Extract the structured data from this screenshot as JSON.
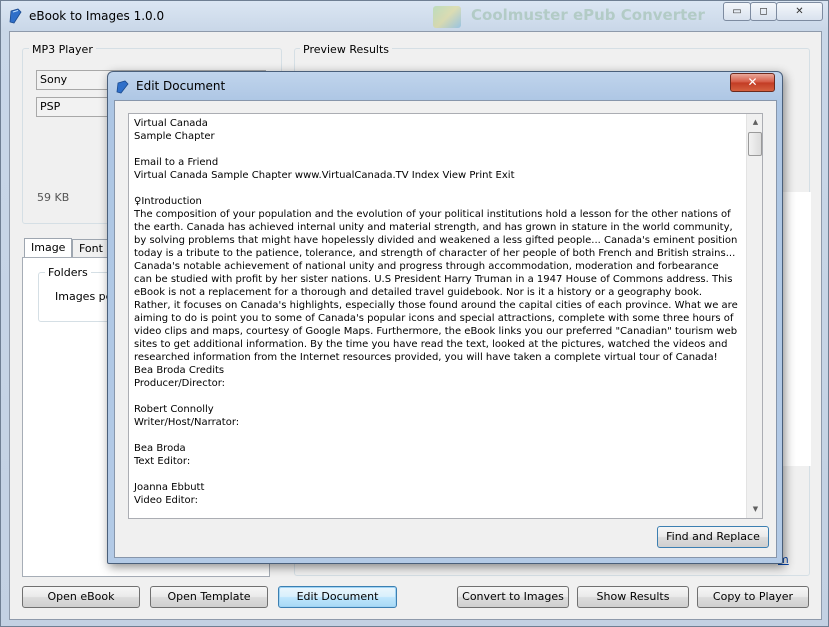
{
  "main_window": {
    "title": "eBook to Images 1.0.0",
    "background_app_title": "Coolmuster ePub Converter",
    "caption_buttons": {
      "minimize": "▭",
      "maximize": "◻",
      "close": "✕"
    }
  },
  "left_panel": {
    "group_title": "MP3 Player",
    "brand_combo": "Sony",
    "model_combo": "PSP",
    "size_label": "59 KB",
    "tabs": [
      "Image",
      "Font"
    ],
    "folders_group": "Folders",
    "images_per_label": "Images per"
  },
  "preview_panel": {
    "group_title": "Preview Results"
  },
  "bottom_buttons": {
    "open_ebook": "Open eBook",
    "open_template": "Open Template",
    "edit_document": "Edit Document",
    "convert_to_images": "Convert to Images",
    "show_results": "Show Results",
    "copy_to_player": "Copy to Player"
  },
  "dialog": {
    "title": "Edit Document",
    "close_symbol": "✕",
    "document_text": "Virtual Canada\nSample Chapter\n\nEmail to a Friend\nVirtual Canada Sample Chapter www.VirtualCanada.TV Index View Print Exit\n\n♀Introduction\nThe composition of your population and the evolution of your political institutions hold a lesson for the other nations of the earth. Canada has achieved internal unity and material strength, and has grown in stature in the world community, by solving problems that might have hopelessly divided and weakened a less gifted people... Canada's eminent position today is a tribute to the patience, tolerance, and strength of character of her people of both French and British strains... Canada's notable achievement of national unity and progress through accommodation, moderation and forbearance can be studied with profit by her sister nations. U.S President Harry Truman in a 1947 House of Commons address. This eBook is not a replacement for a thorough and detailed travel guidebook. Nor is it a history or a geography book. Rather, it focuses on Canada's highlights, especially those found around the capital cities of each province. What we are aiming to do is point you to some of Canada's popular icons and special attractions, complete with some three hours of video clips and maps, courtesy of Google Maps. Furthermore, the eBook links you our preferred \"Canadian\" tourism web sites to get additional information. By the time you have read the text, looked at the pictures, watched the videos and researched information from the Internet resources provided, you will have taken a complete virtual tour of Canada! Bea Broda Credits\nProducer/Director:\n\nRobert Connolly\nWriter/Host/Narrator:\n\nBea Broda\nText Editor:\n\nJoanna Ebbutt\nVideo Editor:",
    "find_replace_button": "Find and Replace"
  },
  "link_fragment": "m",
  "colors": {
    "title_bar": "#c9d7e8",
    "close_button": "#c23b24",
    "focus_border": "#3c7fb1",
    "link": "#0645ad"
  }
}
